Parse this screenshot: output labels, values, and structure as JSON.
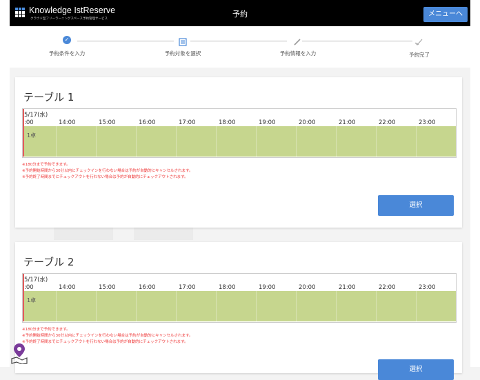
{
  "header": {
    "logo_name": "Knowledge IstReserve",
    "logo_sub": "クラウド型フリーラーニングスペース予約管理サービス",
    "title": "予約",
    "menu_label": "メニューへ"
  },
  "steps": [
    {
      "label": "予約条件を入力",
      "icon": "check-icon"
    },
    {
      "label": "予約対象を選択",
      "icon": "list-icon"
    },
    {
      "label": "予約情報を入力",
      "icon": "pencil-icon"
    },
    {
      "label": "予約完了",
      "icon": "done-icon"
    }
  ],
  "cards": [
    {
      "title": "テーブル 1",
      "date": "5/17(水)",
      "first_hour": ":00",
      "hours": [
        "14:00",
        "15:00",
        "16:00",
        "17:00",
        "18:00",
        "19:00",
        "20:00",
        "21:00",
        "22:00",
        "23:00"
      ],
      "seat": "1卓",
      "notes": [
        "※180分まで予約できます。",
        "※予約開始時間から30分以内にチェックインを行わない場合は予約が自動的にキャンセルされます。",
        "※予約終了時間までにチェックアウトを行わない場合は予約が自動的にチェックアウトされます。"
      ],
      "button": "選択"
    },
    {
      "title": "テーブル 2",
      "date": "5/17(水)",
      "first_hour": ":00",
      "hours": [
        "14:00",
        "15:00",
        "16:00",
        "17:00",
        "18:00",
        "19:00",
        "20:00",
        "21:00",
        "22:00",
        "23:00"
      ],
      "seat": "1卓",
      "notes": [
        "※180分まで予約できます。",
        "※予約開始時間から30分以内にチェックインを行わない場合は予約が自動的にキャンセルされます。",
        "※予約終了時間までにチェックアウトを行わない場合は予約が自動的にチェックアウトされます。"
      ],
      "button": "選択"
    }
  ],
  "colors": {
    "accent": "#4a88d8",
    "timeline_band": "#c6d68e",
    "note_red": "#e33333"
  }
}
